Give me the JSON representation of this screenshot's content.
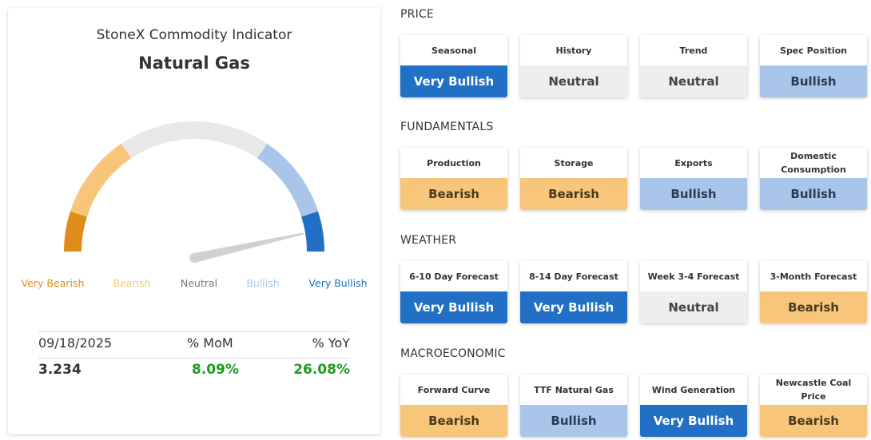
{
  "indicator": {
    "title": "StoneX Commodity Indicator",
    "commodity": "Natural Gas",
    "gauge_level": 0.93,
    "scale_labels": [
      {
        "label": "Very Bearish",
        "color": "#df8c1b"
      },
      {
        "label": "Bearish",
        "color": "#f7c67a"
      },
      {
        "label": "Neutral",
        "color": "#777777"
      },
      {
        "label": "Bullish",
        "color": "#a9c6ea"
      },
      {
        "label": "Very Bullish",
        "color": "#2270c6"
      }
    ],
    "segment_colors": [
      "#df8c1b",
      "#f7c67a",
      "#e8e8e8",
      "#a9c6ea",
      "#2270c6"
    ],
    "needle_color": "#cfd2d3",
    "stats": {
      "date": "09/18/2025",
      "mom_label": "% MoM",
      "yoy_label": "% YoY",
      "price": "3.234",
      "mom": "8.09%",
      "yoy": "26.08%"
    }
  },
  "sections": [
    {
      "title": "PRICE",
      "tiles": [
        {
          "label": "Seasonal",
          "value": "Very Bullish",
          "level": "very-bullish"
        },
        {
          "label": "History",
          "value": "Neutral",
          "level": "neutral"
        },
        {
          "label": "Trend",
          "value": "Neutral",
          "level": "neutral"
        },
        {
          "label": "Spec Position",
          "value": "Bullish",
          "level": "bullish"
        }
      ]
    },
    {
      "title": "FUNDAMENTALS",
      "tiles": [
        {
          "label": "Production",
          "value": "Bearish",
          "level": "bearish"
        },
        {
          "label": "Storage",
          "value": "Bearish",
          "level": "bearish"
        },
        {
          "label": "Exports",
          "value": "Bullish",
          "level": "bullish"
        },
        {
          "label": "Domestic Consumption",
          "value": "Bullish",
          "level": "bullish"
        }
      ]
    },
    {
      "title": "WEATHER",
      "tiles": [
        {
          "label": "6-10 Day Forecast",
          "value": "Very Bullish",
          "level": "very-bullish"
        },
        {
          "label": "8-14 Day Forecast",
          "value": "Very Bullish",
          "level": "very-bullish"
        },
        {
          "label": "Week 3-4 Forecast",
          "value": "Neutral",
          "level": "neutral"
        },
        {
          "label": "3-Month Forecast",
          "value": "Bearish",
          "level": "bearish"
        }
      ]
    },
    {
      "title": "MACROECONOMIC",
      "tiles": [
        {
          "label": "Forward Curve",
          "value": "Bearish",
          "level": "bearish"
        },
        {
          "label": "TTF Natural Gas",
          "value": "Bullish",
          "level": "bullish"
        },
        {
          "label": "Wind Generation",
          "value": "Very Bullish",
          "level": "very-bullish"
        },
        {
          "label": "Newcastle Coal Price",
          "value": "Bearish",
          "level": "bearish"
        }
      ]
    }
  ]
}
